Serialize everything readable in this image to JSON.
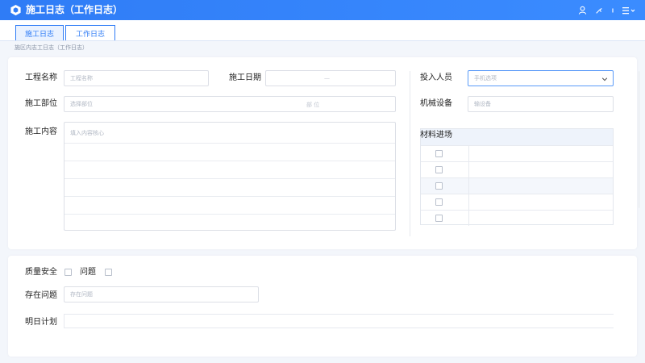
{
  "app": {
    "title": "施工日志（工作日志）"
  },
  "tabs": [
    {
      "label": "施工日志"
    },
    {
      "label": "工作日志"
    }
  ],
  "breadcrumb": "施区内志工日志（工作日志）",
  "form": {
    "project_name": {
      "label": "工程名称",
      "placeholder": "工程名称"
    },
    "date": {
      "label": "施工日期",
      "separator": "—"
    },
    "personnel": {
      "label": "投入人员",
      "placeholder": "手机选项"
    },
    "location": {
      "label": "施工部位",
      "placeholder": "选择部位",
      "suffix": "部 位"
    },
    "machinery": {
      "label": "机械设备",
      "placeholder": "输设备"
    },
    "content": {
      "label": "施工内容",
      "placeholder": "填入内容核心"
    },
    "materials": {
      "label": "材料进场"
    },
    "quality_safety": {
      "label": "质量安全"
    },
    "issue_check": {
      "label": "问题"
    },
    "issues": {
      "label": "存在问题",
      "placeholder": "存在问题"
    },
    "plan": {
      "label": "明日计划"
    }
  },
  "colors": {
    "accent": "#2f7cf6",
    "topbar": "#2f7cf6"
  },
  "icons": [
    "app-logo-icon",
    "user-icon",
    "tool-icon",
    "info-icon",
    "menu-icon",
    "chevron-down-icon"
  ]
}
